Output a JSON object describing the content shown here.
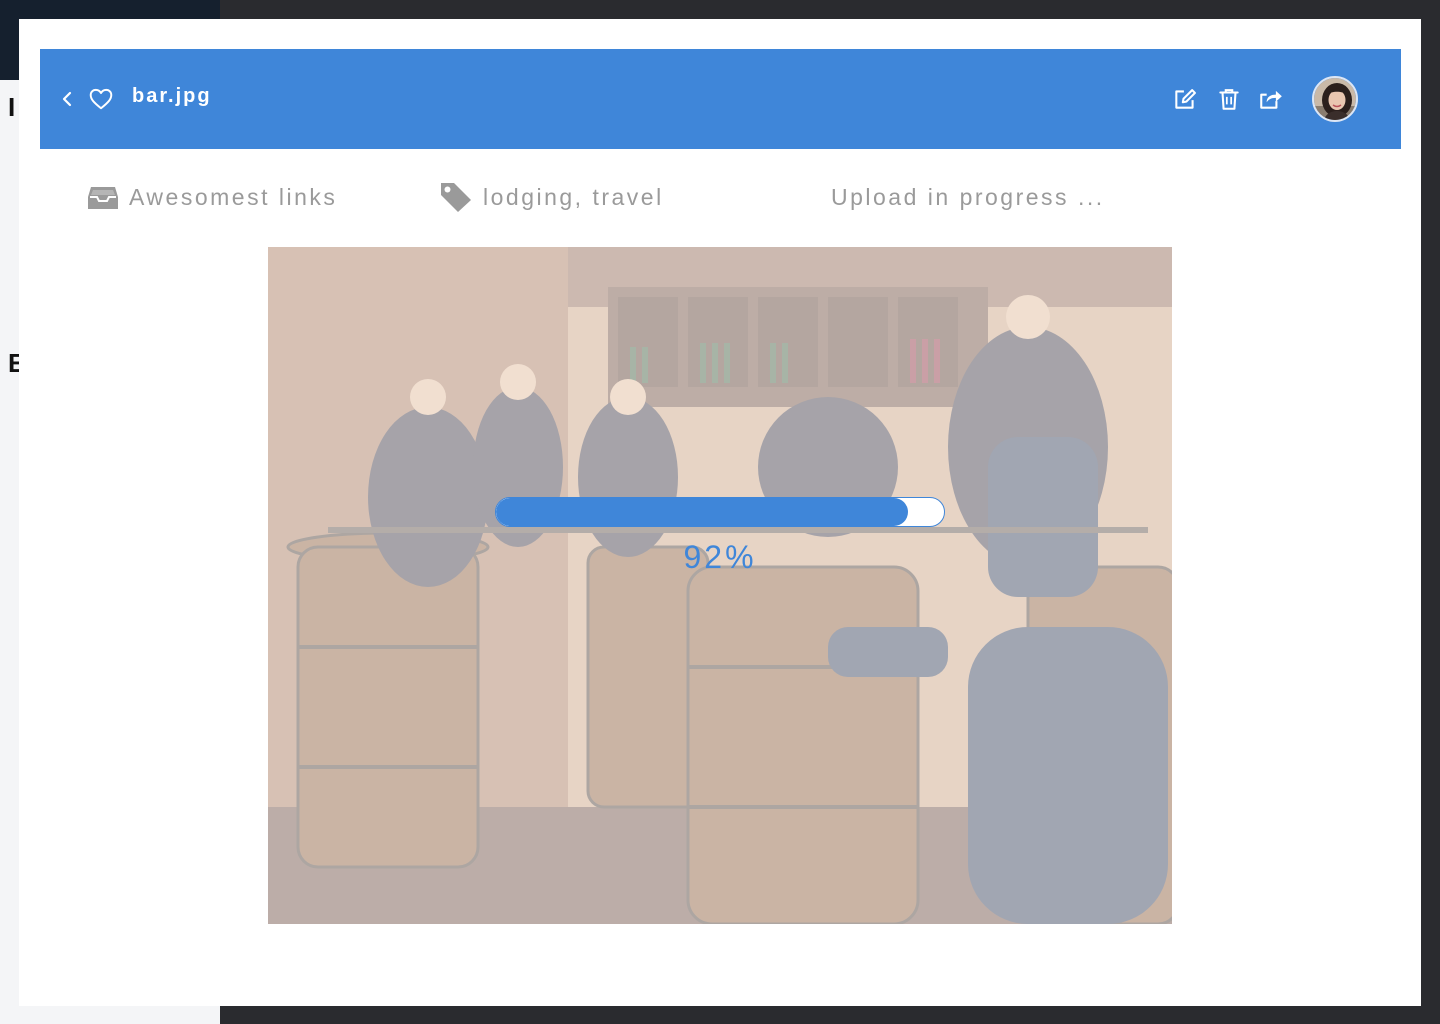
{
  "file": {
    "name": "bar.jpg"
  },
  "meta": {
    "collection": "Awesomest links",
    "tags": "lodging, travel",
    "status": "Upload in progress ..."
  },
  "upload": {
    "percent": 92,
    "label": "92%"
  },
  "background": {
    "letters": [
      "I",
      "E"
    ]
  },
  "icons": {
    "back": "chevron-left-icon",
    "favorite": "heart-icon",
    "edit": "edit-icon",
    "delete": "trash-icon",
    "share": "share-icon",
    "collection": "inbox-icon",
    "tags": "tag-icon"
  },
  "colors": {
    "accent": "#3f86d9",
    "muted_text": "#9a9a9a",
    "overlay_backdrop": "#2a2b2f"
  }
}
